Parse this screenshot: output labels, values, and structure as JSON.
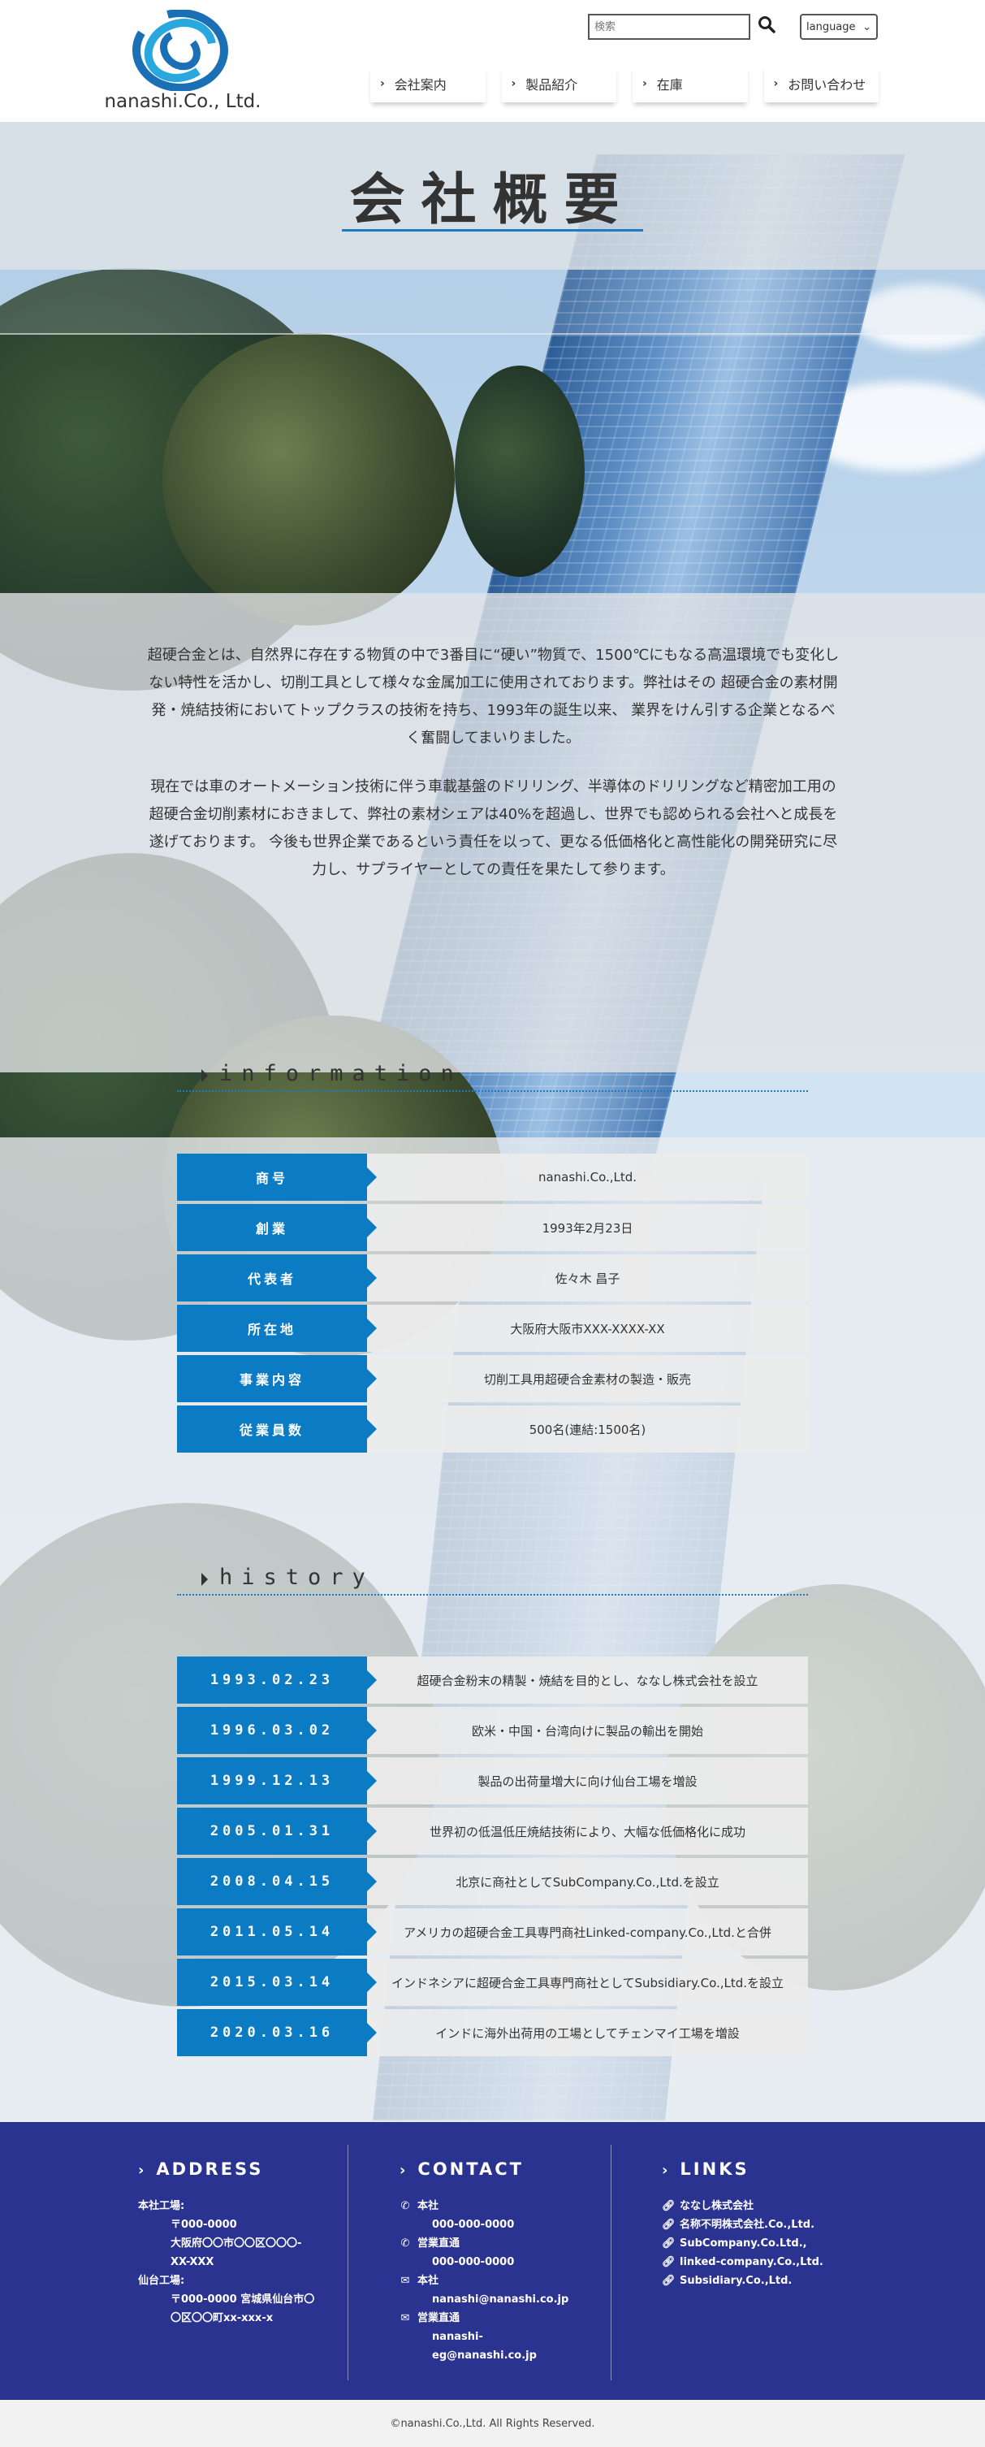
{
  "header": {
    "logo_text": "nanashi.Co., Ltd.",
    "search_placeholder": "検索",
    "language_label": "language",
    "nav": [
      {
        "label": "会社案内"
      },
      {
        "label": "製品紹介"
      },
      {
        "label": "在庫"
      },
      {
        "label": "お問い合わせ"
      }
    ]
  },
  "hero": {
    "title": "会社概要",
    "paragraphs": [
      "超硬合金とは、自然界に存在する物質の中で3番目に“硬い”物質で、1500℃にもなる高温環境でも変化しない特性を活かし、切削工具として様々な金属加工に使用されております。弊社はその 超硬合金の素材開発・焼結技術においてトップクラスの技術を持ち、1993年の誕生以来、 業界をけん引する企業となるべく奮闘してまいりました。",
      "現在では車のオートメーション技術に伴う車載基盤のドリリング、半導体のドリリングなど精密加工用の超硬合金切削素材におきまして、弊社の素材シェアは40%を超過し、世界でも認められる会社へと成長を遂げております。 今後も世界企業であるという責任を以って、更なる低価格化と高性能化の開発研究に尽力し、サプライヤーとしての責任を果たして参ります。"
    ]
  },
  "information": {
    "heading": "information",
    "rows": [
      {
        "key": "商号",
        "value": "nanashi.Co.,Ltd."
      },
      {
        "key": "創業",
        "value": "1993年2月23日"
      },
      {
        "key": "代表者",
        "value": "佐々木 昌子"
      },
      {
        "key": "所在地",
        "value": "大阪府大阪市XXX-XXXX-XX"
      },
      {
        "key": "事業内容",
        "value": "切削工具用超硬合金素材の製造・販売"
      },
      {
        "key": "従業員数",
        "value": "500名(連結:1500名)"
      }
    ]
  },
  "history": {
    "heading": "history",
    "rows": [
      {
        "date": "1993.02.23",
        "event": "超硬合金粉末の精製・焼結を目的とし、ななし株式会社を設立"
      },
      {
        "date": "1996.03.02",
        "event": "欧米・中国・台湾向けに製品の輸出を開始"
      },
      {
        "date": "1999.12.13",
        "event": "製品の出荷量増大に向け仙台工場を増設"
      },
      {
        "date": "2005.01.31",
        "event": "世界初の低温低圧焼結技術により、大幅な低価格化に成功"
      },
      {
        "date": "2008.04.15",
        "event": "北京に商社としてSubCompany.Co.,Ltd.を設立"
      },
      {
        "date": "2011.05.14",
        "event": "アメリカの超硬合金工具専門商社Linked-company.Co.,Ltd.と合併"
      },
      {
        "date": "2015.03.14",
        "event": "インドネシアに超硬合金工具専門商社としてSubsidiary.Co.,Ltd.を設立"
      },
      {
        "date": "2020.03.16",
        "event": "インドに海外出荷用の工場としてチェンマイ工場を増設"
      }
    ]
  },
  "footer": {
    "address": {
      "heading": "ADDRESS",
      "head_office_label": "本社工場:",
      "head_office_zip": "〒000-0000",
      "head_office_addr1": "大阪府〇〇市〇〇区〇〇〇-",
      "head_office_addr2": "XX-XXX",
      "sendai_label": "仙台工場:",
      "sendai_addr1": "〒000-0000 宮城県仙台市〇",
      "sendai_addr2": "〇区〇〇町xx-xxx-x"
    },
    "contact": {
      "heading": "CONTACT",
      "items": [
        {
          "label": "本社",
          "value": "000-000-0000",
          "icon": "phone-icon"
        },
        {
          "label": "営業直通",
          "value": "000-000-0000",
          "icon": "phone-icon"
        },
        {
          "label": "本社",
          "value": "nanashi@nanashi.co.jp",
          "icon": "mail-icon"
        },
        {
          "label": "営業直通",
          "value": "nanashi-",
          "value2": "eg@nanashi.co.jp",
          "icon": "mail-icon"
        }
      ]
    },
    "links": {
      "heading": "LINKS",
      "items": [
        {
          "label": "ななし株式会社"
        },
        {
          "label": "名称不明株式会社.Co.,Ltd."
        },
        {
          "label": "SubCompany.Co.Ltd.,"
        },
        {
          "label": "linked-company.Co.,Ltd."
        },
        {
          "label": "Subsidiary.Co.,Ltd."
        }
      ]
    },
    "copyright": "©nanashi.Co.,Ltd. All Rights Reserved."
  },
  "colors": {
    "accent_blue": "#0b7cc4",
    "footer_navy": "#2b3390",
    "logo_blue": "#1a6fb5",
    "logo_cyan": "#29a8de"
  }
}
